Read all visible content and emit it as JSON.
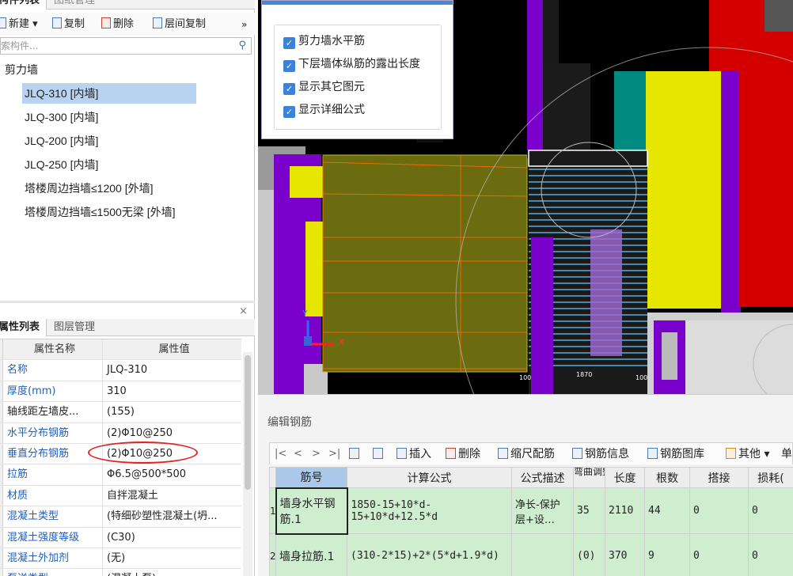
{
  "top_panel": {
    "tabs": [
      "构件列表",
      "图纸管理"
    ],
    "toolbar": {
      "new_label": "新建",
      "copy_label": "复制",
      "delete_label": "删除",
      "floor_copy_label": "层间复制",
      "more_label": "»"
    },
    "search_placeholder": "索构件...",
    "tree_root": "剪力墙",
    "tree_items": [
      "JLQ-310 [内墙]",
      "JLQ-300 [内墙]",
      "JLQ-200 [内墙]",
      "JLQ-250 [内墙]",
      "塔楼周边挡墙≤1200 [外墙]",
      "塔楼周边挡墙≤1500无梁 [外墙]"
    ],
    "selected_index": 0
  },
  "bottom_panel": {
    "tabs": [
      "属性列表",
      "图层管理"
    ],
    "close_label": "×",
    "header": {
      "name": "属性名称",
      "value": "属性值"
    },
    "rows": [
      {
        "name": "名称",
        "value": "JLQ-310",
        "highlight": true
      },
      {
        "name": "厚度(mm)",
        "value": "310",
        "highlight": true
      },
      {
        "name": "轴线距左墙皮...",
        "value": "(155)",
        "highlight": false
      },
      {
        "name": "水平分布钢筋",
        "value": "(2)Φ10@250",
        "highlight": true
      },
      {
        "name": "垂直分布钢筋",
        "value": "(2)Φ10@250",
        "highlight": true,
        "circled": true
      },
      {
        "name": "拉筋",
        "value": "Φ6.5@500*500",
        "highlight": true
      },
      {
        "name": "材质",
        "value": "自拌混凝土",
        "highlight": true
      },
      {
        "name": "混凝土类型",
        "value": "(特细砂塑性混凝土(坍...",
        "highlight": true
      },
      {
        "name": "混凝土强度等级",
        "value": "(C30)",
        "highlight": true
      },
      {
        "name": "混凝土外加剂",
        "value": "(无)",
        "highlight": true
      },
      {
        "name": "泵送类型",
        "value": "(混凝土泵)",
        "highlight": true
      }
    ]
  },
  "popup": {
    "options": [
      {
        "label": "剪力墙水平筋",
        "checked": true
      },
      {
        "label": "下层墙体纵筋的露出长度",
        "checked": true
      },
      {
        "label": "显示其它图元",
        "checked": true
      },
      {
        "label": "显示详细公式",
        "checked": true
      }
    ]
  },
  "canvas": {
    "axis_y": "Y",
    "axis_x": "X",
    "dims": [
      "100",
      "1870",
      "100"
    ]
  },
  "editor": {
    "title": "编辑钢筋",
    "toolbar": {
      "nav": [
        "|<",
        "<",
        ">",
        ">|"
      ],
      "insert": "插入",
      "delete": "删除",
      "scale": "缩尺配筋",
      "info": "钢筋信息",
      "library": "钢筋图库",
      "other": "其他",
      "single": "单"
    },
    "columns": [
      "筋号",
      "计算公式",
      "公式描述",
      "弯曲调整",
      "长度",
      "根数",
      "搭接",
      "损耗("
    ],
    "rows": [
      {
        "num": "1",
        "name": "墙身水平钢筋.1",
        "formula": "1850-15+10*d-15+10*d+12.5*d",
        "desc": "净长-保护层+设…",
        "bend": "35",
        "length": "2110",
        "count": "44",
        "lap": "0",
        "loss": "0"
      },
      {
        "num": "2",
        "name": "墙身拉筋.1",
        "formula": "(310-2*15)+2*(5*d+1.9*d)",
        "desc": "",
        "bend": "(0)",
        "length": "370",
        "count": "9",
        "lap": "0",
        "loss": "0"
      }
    ]
  },
  "colors": {
    "selection": "#b9d2f0",
    "link_blue": "#1f5fbf",
    "row_green": "#cfeecf",
    "header_blue": "#a9c8ea",
    "checkbox": "#3b82d8"
  }
}
